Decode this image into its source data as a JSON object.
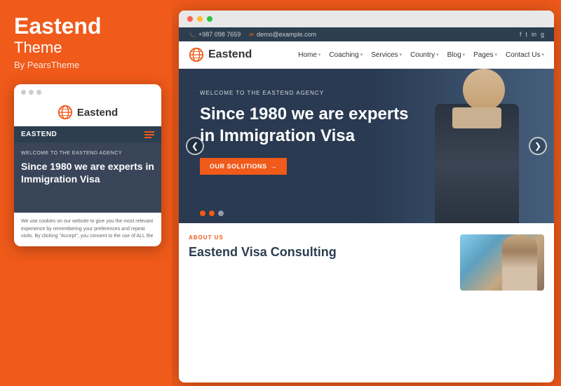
{
  "brand": {
    "name": "Eastend",
    "subtitle": "Theme",
    "by": "By PearsTheme"
  },
  "browser": {
    "dots": [
      "red",
      "yellow",
      "green"
    ]
  },
  "topbar": {
    "phone": "+987 098 7659",
    "email": "demo@example.com",
    "socials": [
      "f",
      "t",
      "in",
      "g"
    ]
  },
  "header": {
    "logo_text": "Eastend",
    "nav_items": [
      {
        "label": "Home",
        "has_arrow": true
      },
      {
        "label": "Coaching",
        "has_arrow": true
      },
      {
        "label": "Services",
        "has_arrow": true
      },
      {
        "label": "Country",
        "has_arrow": true
      },
      {
        "label": "Blog",
        "has_arrow": true
      },
      {
        "label": "Pages",
        "has_arrow": true
      },
      {
        "label": "Contact Us",
        "has_arrow": true
      }
    ]
  },
  "hero": {
    "welcome_text": "WELCOME TO THE EASTEND AGENCY",
    "title_line1": "Since 1980 we are experts",
    "title_line2": "in Immigration Visa",
    "cta_label": "OUR SOLUTIONS",
    "cta_arrow": "→",
    "prev_arrow": "❮",
    "next_arrow": "❯",
    "dots": [
      {
        "active": true
      },
      {
        "active": true
      },
      {
        "active": false
      }
    ]
  },
  "about": {
    "tag": "ABOUT US",
    "title": "Eastend Visa Consulting"
  },
  "mobile": {
    "logo_text": "Eastend",
    "nav_label": "EASTEND",
    "welcome_text": "WELCOME TO THE EASTEND AGENCY",
    "hero_title": "Since 1980 we are experts in Immigration Visa",
    "body_text": "We use cookies on our website to give you the most relevant experience by remembering your preferences and repeat visits. By clicking \"Accept\", you consent to the use of ALL the"
  }
}
